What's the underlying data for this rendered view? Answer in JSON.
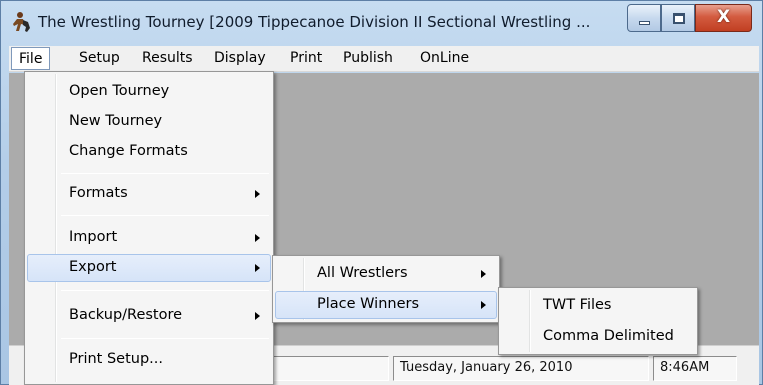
{
  "window": {
    "title": "The Wrestling Tourney [2009 Tippecanoe Division II Sectional Wrestling ...",
    "icon": "wrestler-app-icon",
    "close_glyph": "X"
  },
  "menubar": {
    "items": [
      "File",
      "Setup",
      "Results",
      "Display",
      "Print",
      "Publish",
      "OnLine"
    ]
  },
  "file_menu": {
    "items": [
      {
        "label": "Open Tourney"
      },
      {
        "label": "New Tourney"
      },
      {
        "label": "Change Formats"
      },
      {
        "label": "Formats",
        "submenu": true
      },
      {
        "label": "Import",
        "submenu": true
      },
      {
        "label": "Export",
        "submenu": true,
        "highlighted": true
      },
      {
        "label": "Backup/Restore",
        "submenu": true
      },
      {
        "label": "Print Setup..."
      }
    ]
  },
  "export_menu": {
    "items": [
      {
        "label": "All Wrestlers",
        "submenu": true
      },
      {
        "label": "Place Winners",
        "submenu": true,
        "highlighted": true
      }
    ]
  },
  "place_winners_menu": {
    "items": [
      {
        "label": "TWT Files"
      },
      {
        "label": "Comma Delimited"
      }
    ]
  },
  "statusbar": {
    "date": "Tuesday, January 26, 2010",
    "time": "8:46AM"
  },
  "colors": {
    "client_bg": "#ababab",
    "highlight": "#d6e4f8",
    "close_button": "#c13f22"
  }
}
